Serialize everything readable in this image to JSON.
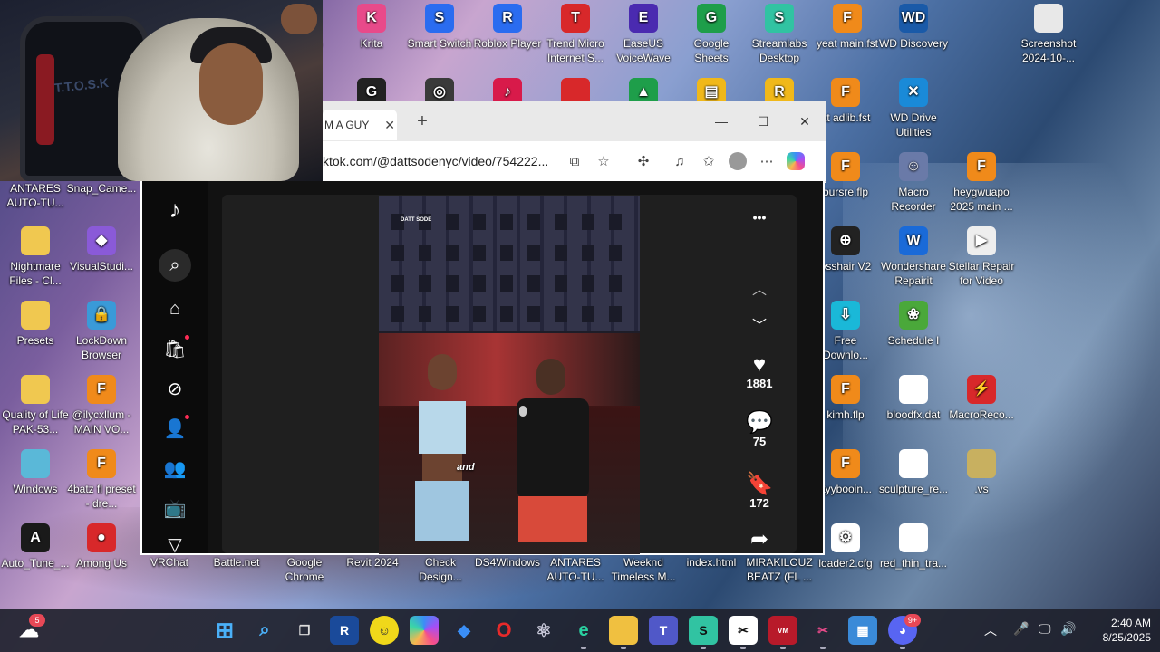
{
  "desktop": {
    "top_row": [
      {
        "label": "Krita",
        "color": "#e84a8a",
        "glyph": "K"
      },
      {
        "label": "Smart Switch",
        "color": "#2a6cf0",
        "glyph": "S"
      },
      {
        "label": "Roblox Player",
        "color": "#2a6cf0",
        "glyph": "R"
      },
      {
        "label": "Trend Micro Internet S...",
        "color": "#d8282a",
        "glyph": "T"
      },
      {
        "label": "EaseUS VoiceWave",
        "color": "#4a2ab0",
        "glyph": "E"
      },
      {
        "label": "Google Sheets",
        "color": "#1e9e4a",
        "glyph": "G"
      },
      {
        "label": "Streamlabs Desktop",
        "color": "#31c3a2",
        "glyph": "S"
      },
      {
        "label": "yeat main.fst",
        "color": "#f08a1a",
        "glyph": "F"
      },
      {
        "label": "WD Discovery",
        "color": "#1a5aa8",
        "glyph": "WD"
      },
      {
        "label": "Screenshot 2024-10-...",
        "color": "#e8e8e8",
        "glyph": ""
      }
    ],
    "partial_first_label": "5",
    "second_row_partial": [
      {
        "label": "",
        "color": "#222",
        "glyph": "G"
      },
      {
        "label": "",
        "color": "#3a3a3a",
        "glyph": "◎"
      },
      {
        "label": "",
        "color": "#d81a4a",
        "glyph": "♪"
      },
      {
        "label": "",
        "color": "#d8282a",
        "glyph": ""
      },
      {
        "label": "",
        "color": "#1e9e4a",
        "glyph": "▲"
      },
      {
        "label": "",
        "color": "#f0b81a",
        "glyph": "▤"
      },
      {
        "label": "",
        "color": "#f0b81a",
        "glyph": "R"
      }
    ],
    "right_icons": [
      {
        "label": "at adlib.fst",
        "color": "#f08a1a",
        "glyph": "F"
      },
      {
        "label": "WD Drive Utilities",
        "color": "#1a8ad8",
        "glyph": "✕"
      },
      {
        "label": "oursre.flp",
        "color": "#f08a1a",
        "glyph": "F"
      },
      {
        "label": "Macro Recorder",
        "color": "#6a7aa8",
        "glyph": "☺"
      },
      {
        "label": "heygwuapo 2025 main ...",
        "color": "#f08a1a",
        "glyph": "F"
      },
      {
        "label": "osshair V2",
        "color": "#222",
        "glyph": "⊕"
      },
      {
        "label": "Wondershare Repairit",
        "color": "#1a6ad8",
        "glyph": "W"
      },
      {
        "label": "Stellar Repair for Video",
        "color": "#eee",
        "glyph": "▶"
      },
      {
        "label": "Free Downlo...",
        "color": "#1ab8d8",
        "glyph": "⇩"
      },
      {
        "label": "Schedule I",
        "color": "#4aa83a",
        "glyph": "❀"
      },
      {
        "label": "kimh.flp",
        "color": "#f08a1a",
        "glyph": "F"
      },
      {
        "label": "bloodfx.dat",
        "color": "#fff",
        "glyph": ""
      },
      {
        "label": "MacroReco...",
        "color": "#d8282a",
        "glyph": "⚡"
      },
      {
        "label": "ayybooin...",
        "color": "#f08a1a",
        "glyph": "F"
      },
      {
        "label": "sculpture_re...",
        "color": "#fff",
        "glyph": ""
      },
      {
        "label": ".vs",
        "color": "#c8b060",
        "glyph": ""
      },
      {
        "label": "loader2.cfg",
        "color": "#fff",
        "glyph": "⚙"
      },
      {
        "label": "red_thin_tra...",
        "color": "#fff",
        "glyph": ""
      }
    ],
    "left_icons": [
      {
        "label": "ANTARES AUTO-TU...",
        "color": "",
        "glyph": ""
      },
      {
        "label": "Snap_Came...",
        "color": "",
        "glyph": ""
      },
      {
        "label": "Nightmare Files - Cl...",
        "color": "#f0c850",
        "glyph": ""
      },
      {
        "label": "VisualStudi...",
        "color": "#8a5ad8",
        "glyph": "◆"
      },
      {
        "label": "Presets",
        "color": "#f0c850",
        "glyph": ""
      },
      {
        "label": "LockDown Browser",
        "color": "#3a9ad8",
        "glyph": "🔒"
      },
      {
        "label": "Quality of Life PAK-53...",
        "color": "#f0c850",
        "glyph": ""
      },
      {
        "label": "@ilycxllum - MAIN VO...",
        "color": "#f08a1a",
        "glyph": "F"
      },
      {
        "label": "Windows",
        "color": "#5ab8d8",
        "glyph": ""
      },
      {
        "label": "4batz fl preset - dre...",
        "color": "#f08a1a",
        "glyph": "F"
      },
      {
        "label": "Auto_Tune_...",
        "color": "#1a1a1a",
        "glyph": "A"
      },
      {
        "label": "Among Us",
        "color": "#d8282a",
        "glyph": "●"
      }
    ],
    "bottom_row": [
      {
        "label": "VRChat"
      },
      {
        "label": "Battle.net"
      },
      {
        "label": "Google Chrome"
      },
      {
        "label": "Revit 2024"
      },
      {
        "label": "Check Design..."
      },
      {
        "label": "DS4Windows"
      },
      {
        "label": "ANTARES AUTO-TU..."
      },
      {
        "label": "Weeknd Timeless M..."
      },
      {
        "label": "index.html"
      },
      {
        "label": "MIRAKILOUZ BEATZ (FL ..."
      }
    ]
  },
  "webcam": {
    "jacket_text": "T.T.O.S.K"
  },
  "browser": {
    "tab_title": "M A GUY",
    "tab_close": "✕",
    "new_tab": "+",
    "url": "ktok.com/@dattsodenyc/video/754222...",
    "minimize": "—",
    "maximize": "☐",
    "close": "✕"
  },
  "tiktok": {
    "logo": "♪",
    "video_watermark": "DATT SODE",
    "caption_word": "and",
    "more": "•••",
    "likes": "1881",
    "comments": "75",
    "saves": "172"
  },
  "taskbar": {
    "weather_badge": "5",
    "discord_badge": "9+",
    "time": "2:40 AM",
    "date": "8/25/2025"
  }
}
